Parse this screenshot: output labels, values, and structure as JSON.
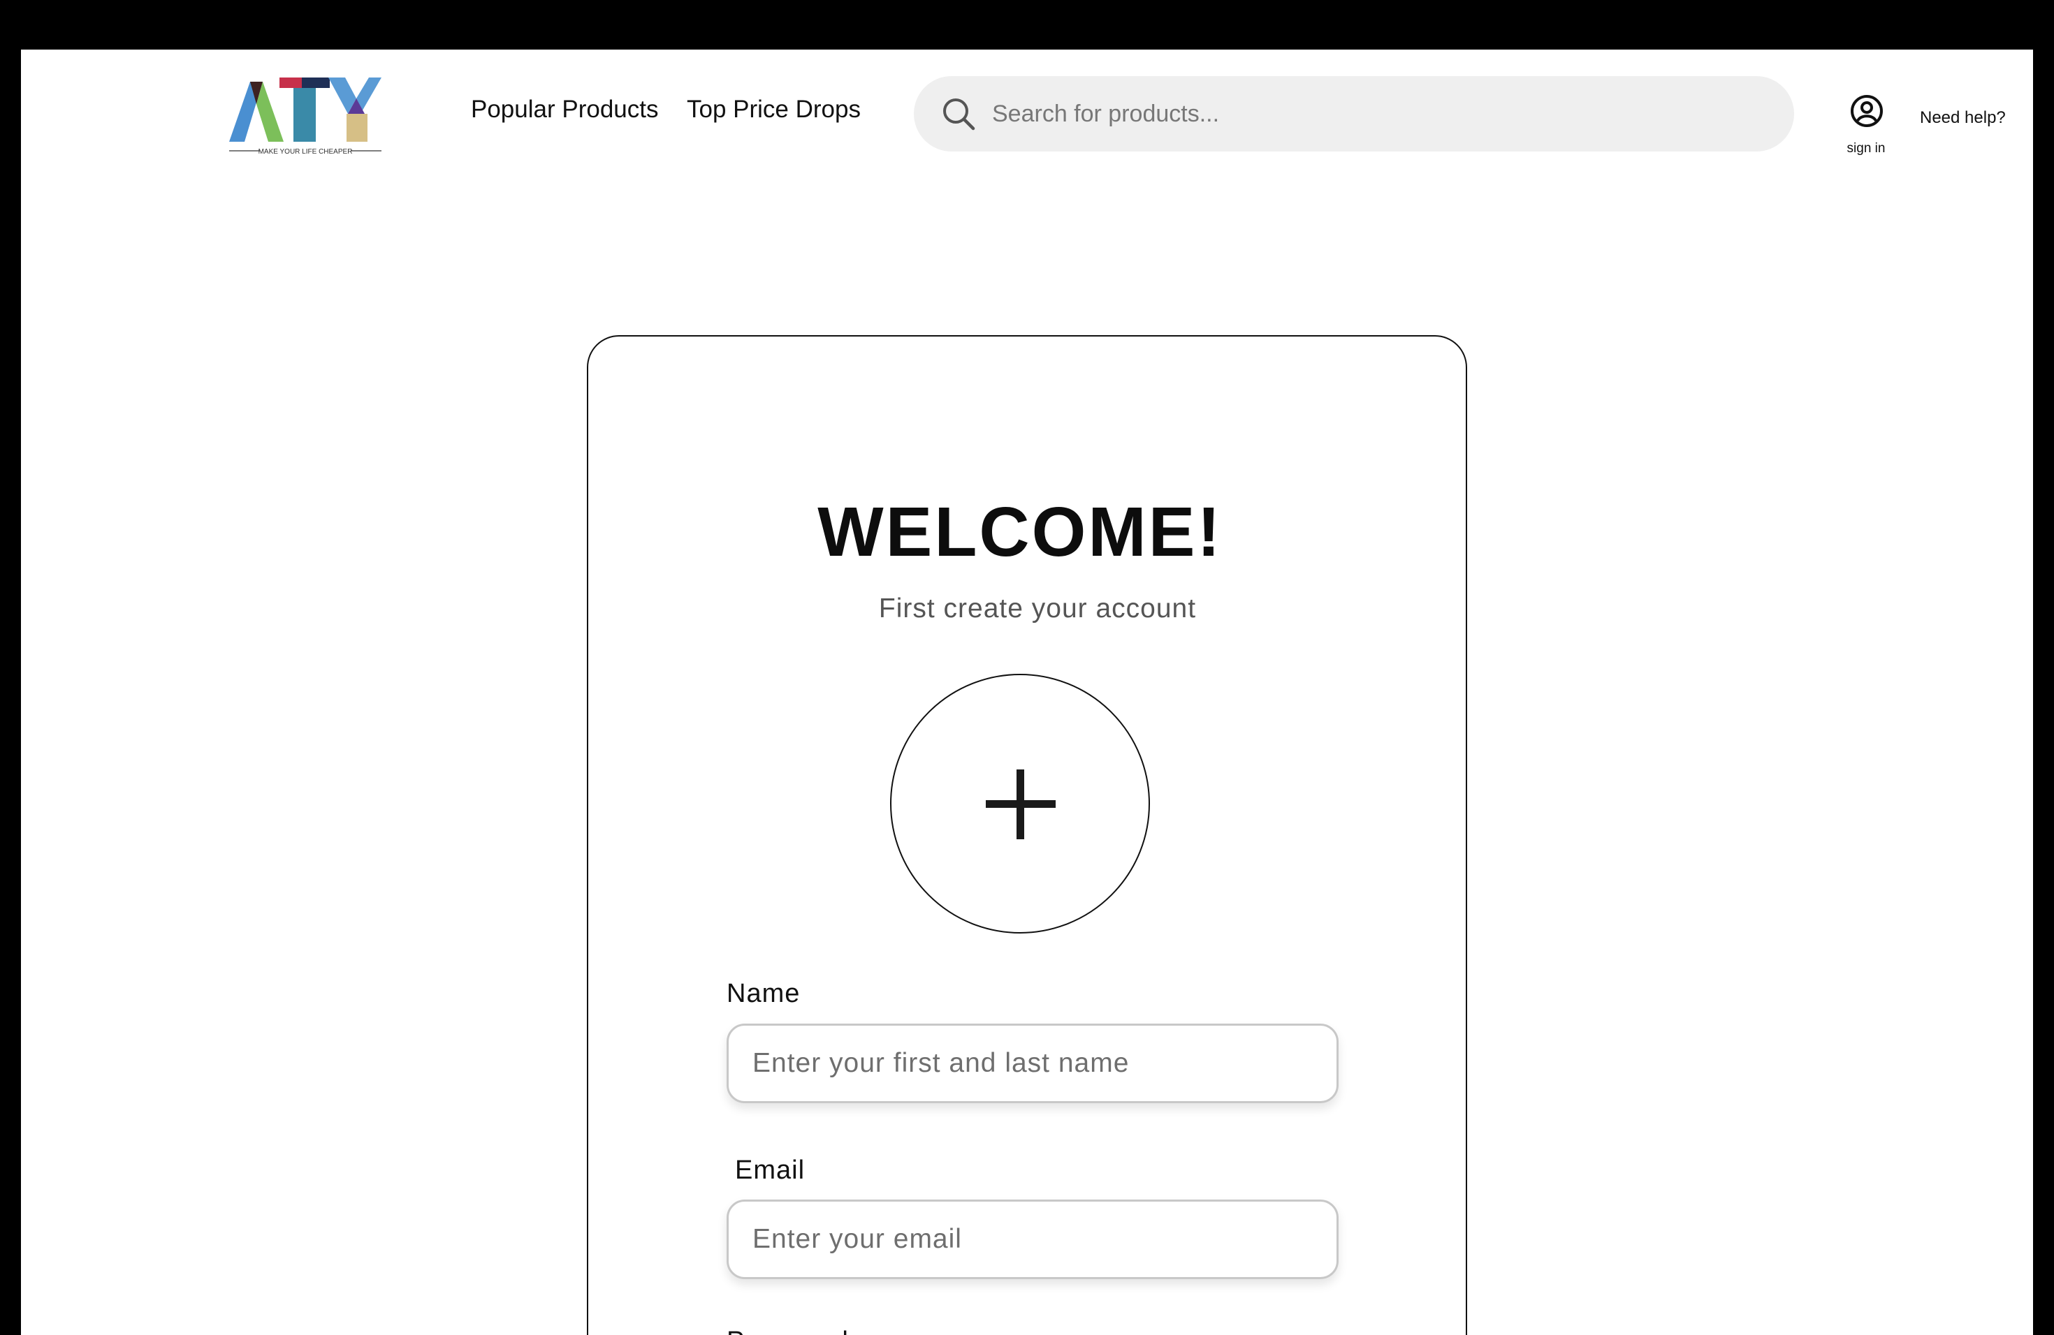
{
  "header": {
    "logo": {
      "wordmark": "ATY",
      "tagline": "MAKE YOUR LIFE CHEAPER",
      "colors": {
        "a_left": "#4a8fd1",
        "a_mid": "#3e2222",
        "a_right": "#7cbf5a",
        "t_bar_left": "#c7304a",
        "t_bar_right": "#1f2f56",
        "t_stem": "#3a8aa8",
        "y_left": "#5a9bd5",
        "y_center": "#5b3a97",
        "y_stem": "#d6bf86"
      }
    },
    "nav": [
      {
        "label": "Popular Products"
      },
      {
        "label": "Top Price Drops"
      }
    ],
    "search": {
      "placeholder": "Search for products...",
      "icon": "search-icon"
    },
    "account": {
      "icon": "user-circle-icon",
      "label": "sign in"
    },
    "help": {
      "label": "Need help?"
    }
  },
  "signup": {
    "title": "WELCOME!",
    "subtitle": "First create your account",
    "avatar_upload_icon": "plus-icon",
    "fields": [
      {
        "label": "Name",
        "placeholder": "Enter your first and last name",
        "value": ""
      },
      {
        "label": "Email",
        "placeholder": "Enter your email",
        "value": ""
      },
      {
        "label": "Password"
      }
    ]
  },
  "colors": {
    "page_background": "#ffffff",
    "frame": "#000000",
    "search_background": "#efefef",
    "input_border": "#c8c8c8",
    "text": "#111111",
    "muted_text": "#555555"
  }
}
